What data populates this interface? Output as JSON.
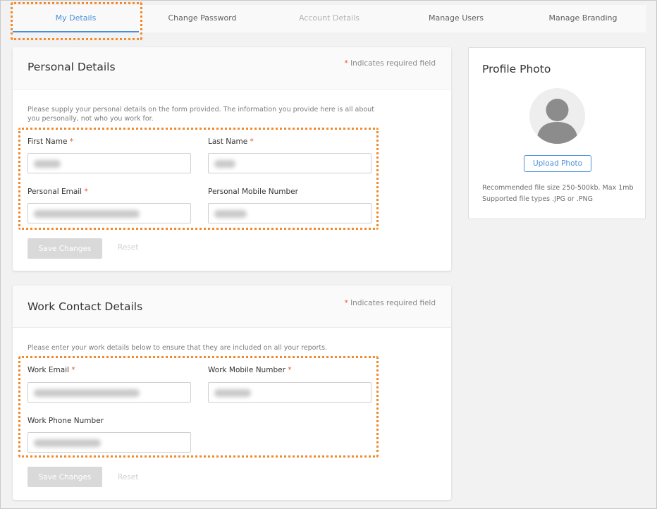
{
  "tabs": [
    {
      "label": "My Details",
      "state": "active"
    },
    {
      "label": "Change Password",
      "state": "normal"
    },
    {
      "label": "Account Details",
      "state": "disabled"
    },
    {
      "label": "Manage Users",
      "state": "normal"
    },
    {
      "label": "Manage Branding",
      "state": "normal"
    }
  ],
  "personal": {
    "title": "Personal Details",
    "required_star": "*",
    "required_note": "Indicates required field",
    "intro": "Please supply your personal details on the form provided. The information you provide here is all about you personally, not who you work for.",
    "first_name_label": "First Name",
    "first_name_value": "",
    "last_name_label": "Last Name",
    "last_name_value": "",
    "email_label": "Personal Email",
    "email_value": "",
    "mobile_label": "Personal Mobile Number",
    "mobile_value": "",
    "save_label": "Save Changes",
    "reset_label": "Reset"
  },
  "work": {
    "title": "Work Contact Details",
    "required_star": "*",
    "required_note": "Indicates required field",
    "intro": "Please enter your work details below to ensure that they are included on all your reports.",
    "email_label": "Work Email",
    "email_value": "",
    "mobile_label": "Work Mobile Number",
    "mobile_value": "",
    "phone_label": "Work Phone Number",
    "phone_value": "",
    "save_label": "Save Changes",
    "reset_label": "Reset"
  },
  "photo": {
    "title": "Profile Photo",
    "avatar_icon": "user-silhouette-icon",
    "upload_label": "Upload Photo",
    "hint_size": "Recommended file size 250-500kb. Max 1mb",
    "hint_types": "Supported file types .JPG or .PNG"
  },
  "colors": {
    "accent": "#4a90d9",
    "required": "#e0582b",
    "annotation": "#f08a2a",
    "disabled_button": "#d9d9d9"
  }
}
